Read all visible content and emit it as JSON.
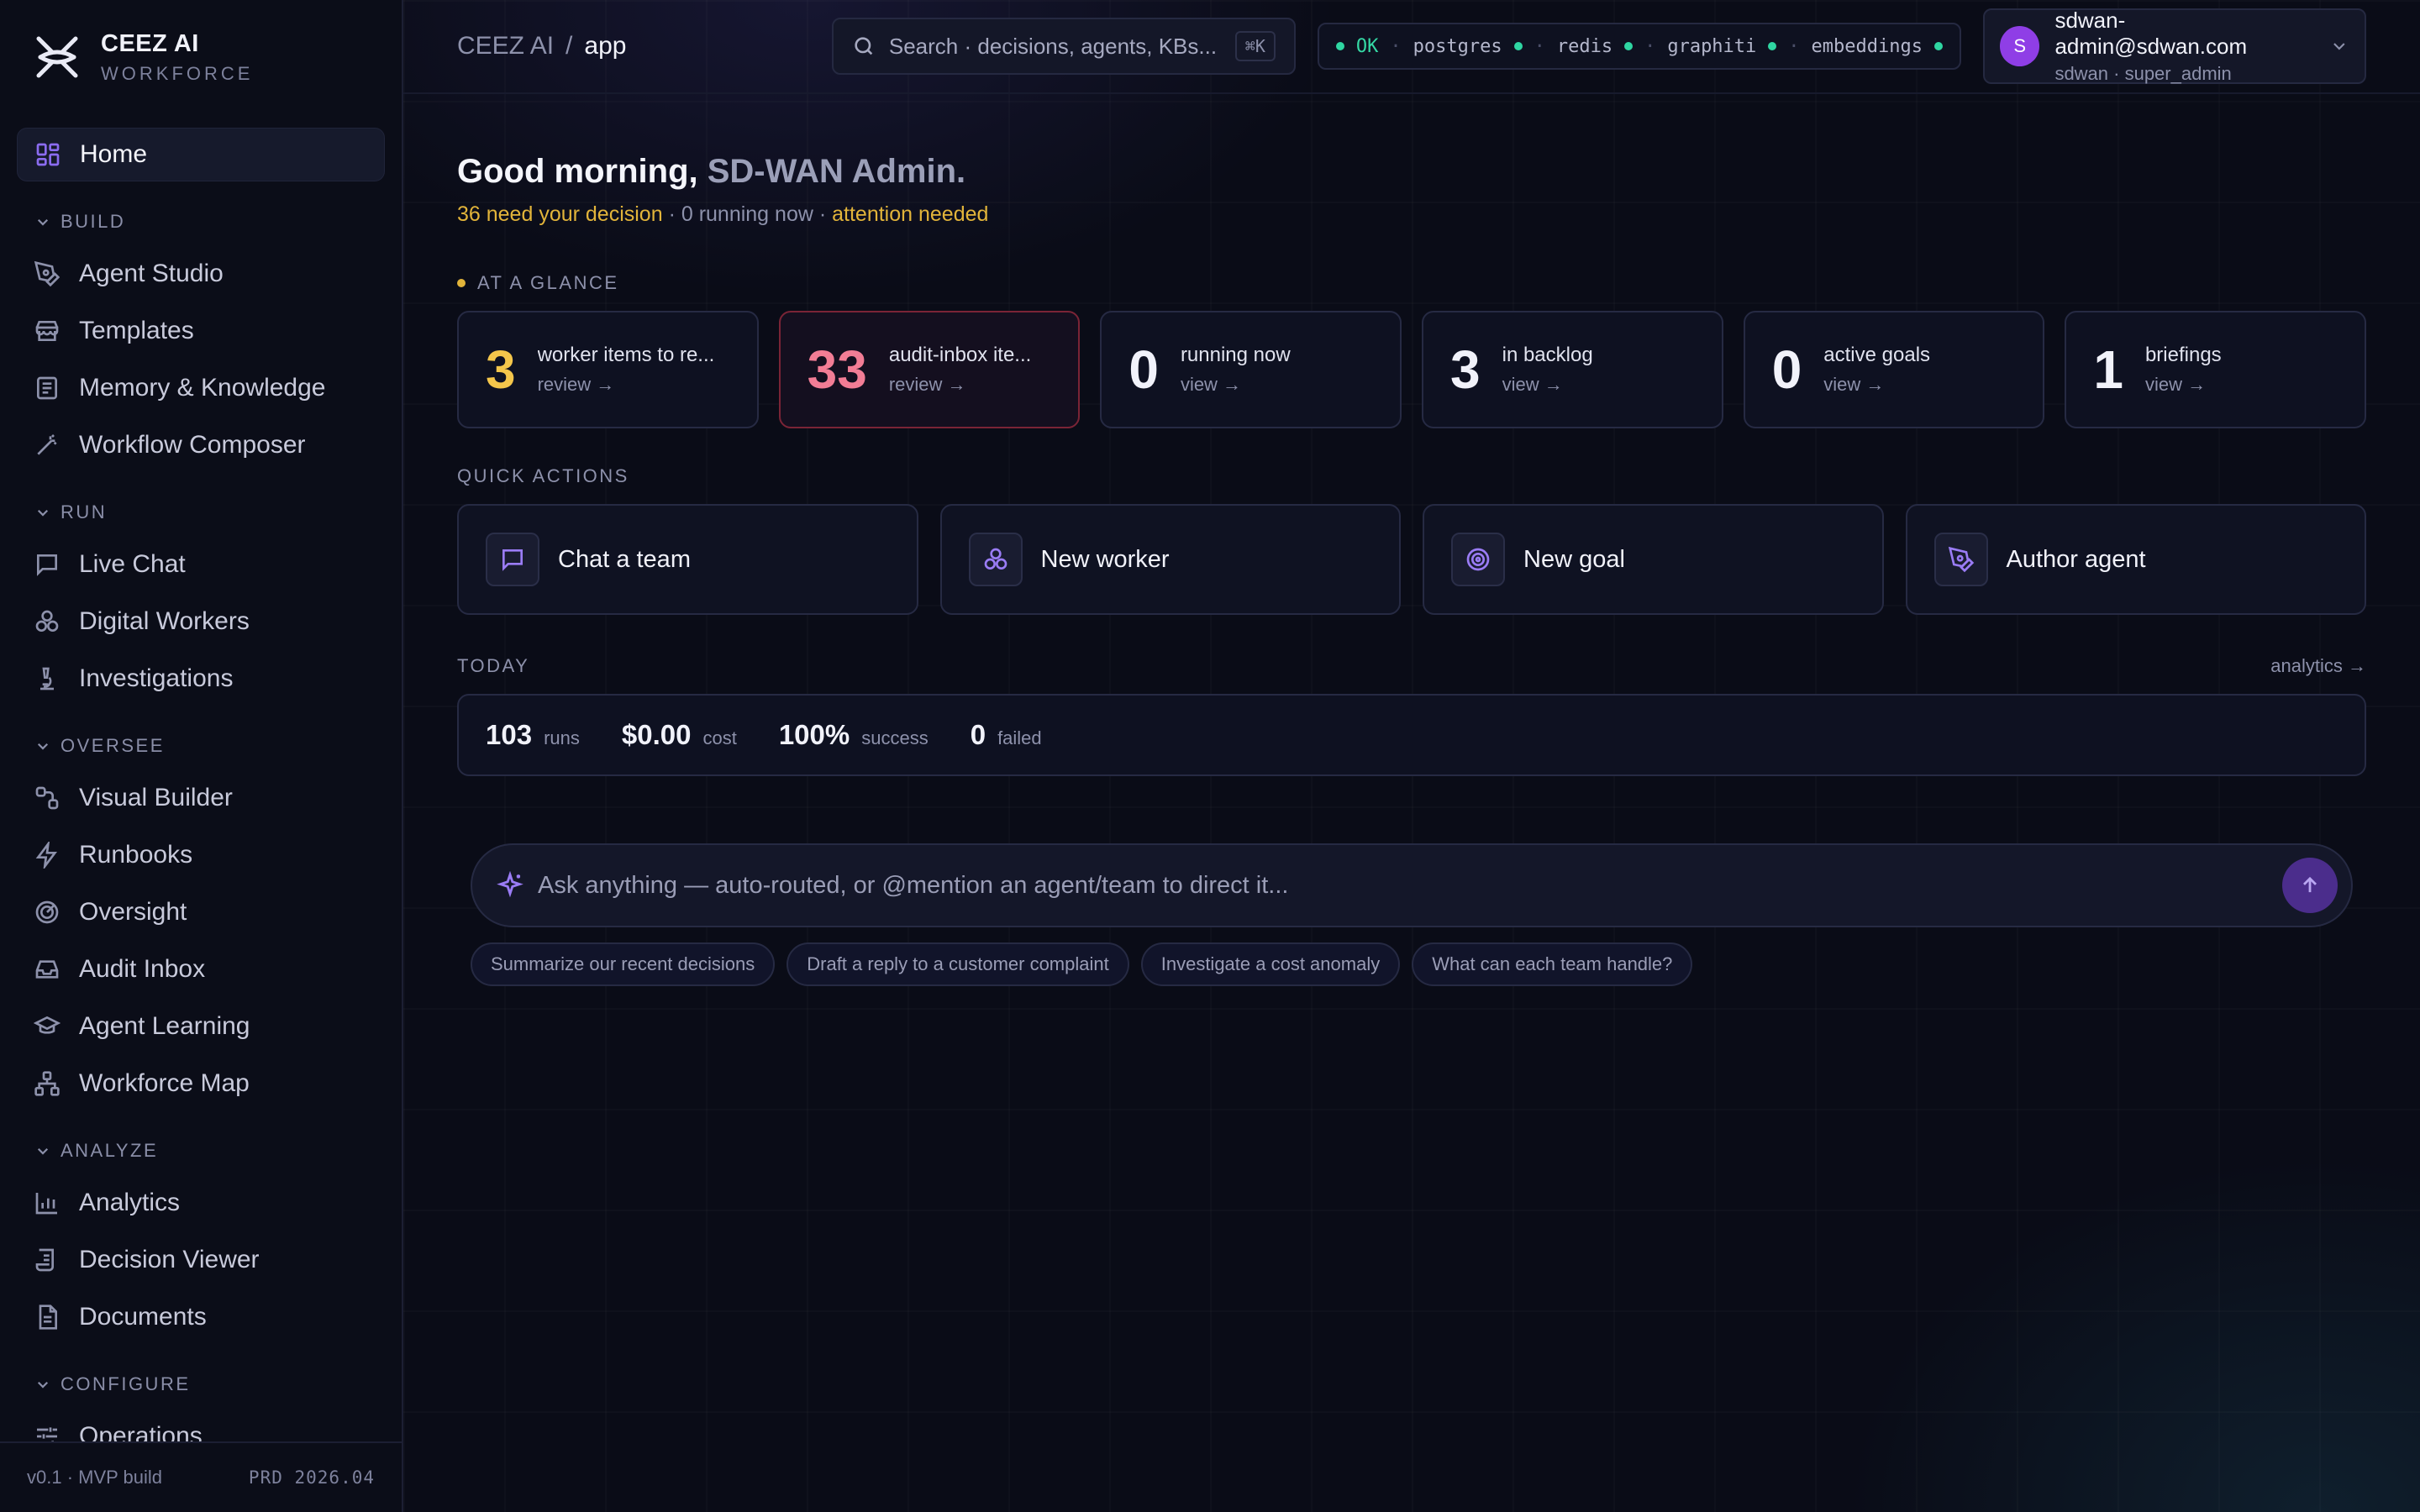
{
  "brand": {
    "name": "CEEZ AI",
    "sub": "WORKFORCE"
  },
  "sidebar": {
    "home": "Home",
    "sections": [
      {
        "title": "BUILD",
        "items": [
          "Agent Studio",
          "Templates",
          "Memory & Knowledge",
          "Workflow Composer"
        ]
      },
      {
        "title": "RUN",
        "items": [
          "Live Chat",
          "Digital Workers",
          "Investigations"
        ]
      },
      {
        "title": "OVERSEE",
        "items": [
          "Visual Builder",
          "Runbooks",
          "Oversight",
          "Audit Inbox",
          "Agent Learning",
          "Workforce Map"
        ]
      },
      {
        "title": "ANALYZE",
        "items": [
          "Analytics",
          "Decision Viewer",
          "Documents"
        ]
      },
      {
        "title": "CONFIGURE",
        "items": [
          "Operations"
        ]
      }
    ],
    "footer": {
      "version": "v0.1 · MVP build",
      "tag": "PRD 2026.04"
    }
  },
  "topbar": {
    "crumb_root": "CEEZ AI",
    "crumb_sep": "/",
    "crumb_current": "app",
    "search_placeholder": "Search · decisions, agents, KBs...",
    "search_kbd": "⌘K",
    "health": {
      "status": "OK",
      "services": [
        "postgres",
        "redis",
        "graphiti",
        "embeddings"
      ]
    },
    "user": {
      "initial": "S",
      "email": "sdwan-admin@sdwan.com",
      "role": "sdwan · super_admin"
    }
  },
  "greeting": {
    "prefix": "Good morning, ",
    "name": "SD-WAN Admin.",
    "need": "36 need your decision",
    "running": " · 0 running now · ",
    "attention": "attention needed"
  },
  "glance": {
    "label": "AT A GLANCE",
    "cards": [
      {
        "num": "3",
        "label": "worker items to re...",
        "link": "review →",
        "tone": "yellow"
      },
      {
        "num": "33",
        "label": "audit-inbox ite...",
        "link": "review →",
        "tone": "pink"
      },
      {
        "num": "0",
        "label": "running now",
        "link": "view →",
        "tone": ""
      },
      {
        "num": "3",
        "label": "in backlog",
        "link": "view →",
        "tone": ""
      },
      {
        "num": "0",
        "label": "active goals",
        "link": "view →",
        "tone": ""
      },
      {
        "num": "1",
        "label": "briefings",
        "link": "view →",
        "tone": ""
      }
    ]
  },
  "quick_actions": {
    "label": "QUICK ACTIONS",
    "items": [
      "Chat a team",
      "New worker",
      "New goal",
      "Author agent"
    ]
  },
  "today": {
    "label": "TODAY",
    "analytics_link": "analytics →",
    "metrics": [
      {
        "value": "103",
        "key": "runs"
      },
      {
        "value": "$0.00",
        "key": "cost"
      },
      {
        "value": "100%",
        "key": "success"
      },
      {
        "value": "0",
        "key": "failed"
      }
    ]
  },
  "ask": {
    "placeholder": "Ask anything — auto-routed, or @mention an agent/team to direct it...",
    "chips": [
      "Summarize our recent decisions",
      "Draft a reply to a customer complaint",
      "Investigate a cost anomaly",
      "What can each team handle?"
    ]
  }
}
